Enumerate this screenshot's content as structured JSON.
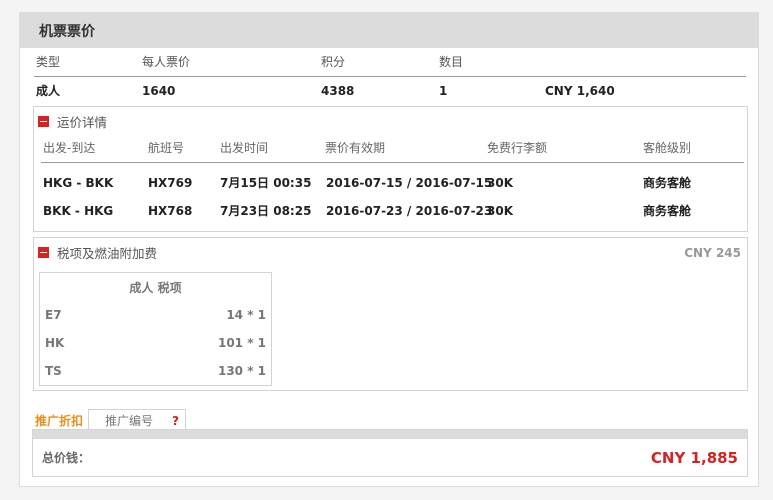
{
  "panel": {
    "title": "机票票价"
  },
  "fare_table": {
    "headers": [
      "类型",
      "每人票价",
      "积分",
      "数目"
    ],
    "row": {
      "type": "成人",
      "price_per_person": "1640",
      "points": "4388",
      "count": "1",
      "subtotal": "CNY 1,640"
    }
  },
  "fare_details": {
    "title": "运价详情",
    "headers": [
      "出发-到达",
      "航班号",
      "出发时间",
      "票价有效期",
      "免费行李额",
      "客舱级别"
    ],
    "rows": [
      {
        "route": "HKG - BKK",
        "flight": "HX769",
        "departure": "7月15日 00:35",
        "validity": "2016-07-15 / 2016-07-15",
        "baggage": "30K",
        "cabin": "商务客舱"
      },
      {
        "route": "BKK - HKG",
        "flight": "HX768",
        "departure": "7月23日 08:25",
        "validity": "2016-07-23 / 2016-07-23",
        "baggage": "30K",
        "cabin": "商务客舱"
      }
    ]
  },
  "taxes": {
    "title": "税项及燃油附加费",
    "total": "CNY 245",
    "table_title": "成人 税项",
    "rows": [
      {
        "code": "E7",
        "amount": "14 * 1"
      },
      {
        "code": "HK",
        "amount": "101 * 1"
      },
      {
        "code": "TS",
        "amount": "130 * 1"
      }
    ]
  },
  "promo": {
    "label": "推广折扣",
    "placeholder": "推广编号",
    "help": "?"
  },
  "total": {
    "label": "总价钱：",
    "value": "CNY 1,885"
  },
  "colors": {
    "accent_red": "#d42323",
    "promo_orange": "#e8901c",
    "header_gray": "#dcdcdc"
  }
}
